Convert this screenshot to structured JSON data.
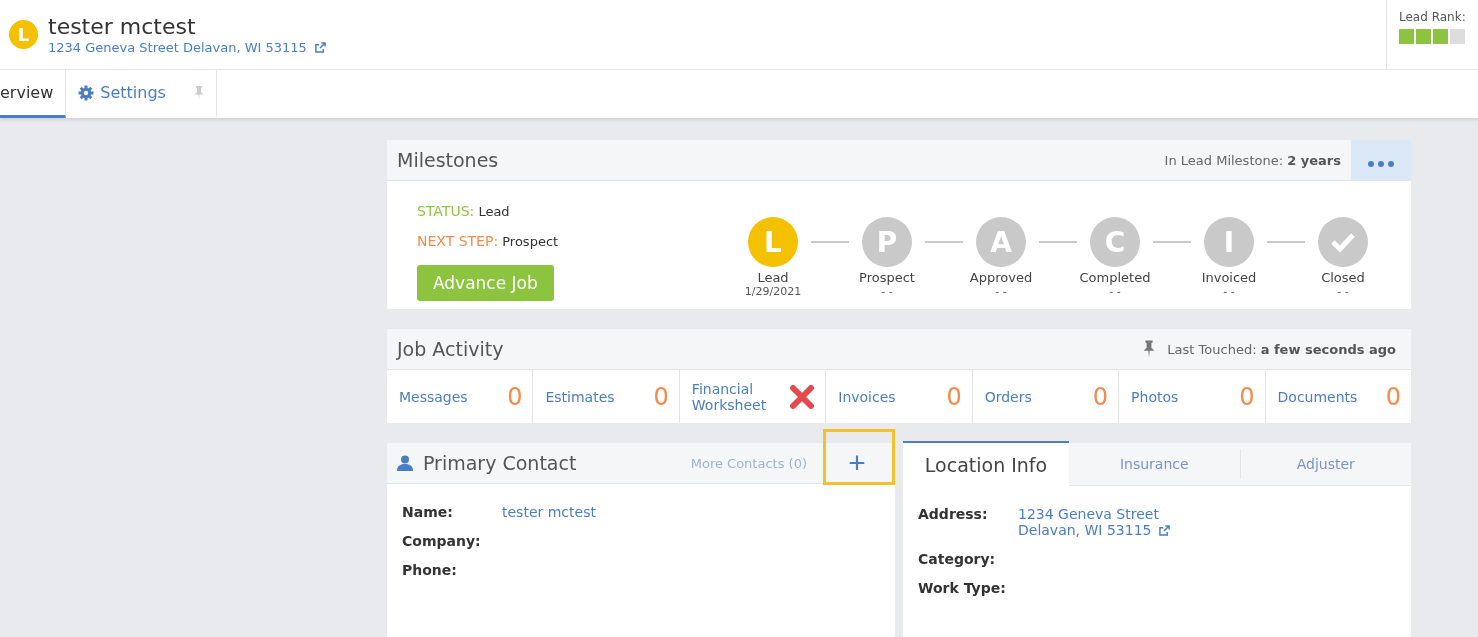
{
  "header": {
    "badge": "L",
    "name": "tester mctest",
    "address": "1234 Geneva Street Delavan, WI 53115",
    "lead_rank": {
      "label": "Lead Rank:",
      "stars": 3
    }
  },
  "tabs": [
    {
      "label": "erview",
      "selected": true
    },
    {
      "label": "Settings",
      "selected": false
    }
  ],
  "milestones": {
    "title": "Milestones",
    "duration_label": "In Lead Milestone:",
    "duration": "2 years",
    "status_label": "STATUS:",
    "status": "Lead",
    "next_label": "NEXT STEP:",
    "next": "Prospect",
    "button": "Advance Job",
    "steps": [
      {
        "kind": "letter",
        "glyph": "L",
        "name": "Lead",
        "date": "1/29/2021",
        "selected": true
      },
      {
        "kind": "letter",
        "glyph": "P",
        "name": "Prospect",
        "date": "- -",
        "selected": false
      },
      {
        "kind": "letter",
        "glyph": "A",
        "name": "Approved",
        "date": "- -",
        "selected": false
      },
      {
        "kind": "letter",
        "glyph": "C",
        "name": "Completed",
        "date": "- -",
        "selected": false
      },
      {
        "kind": "letter",
        "glyph": "I",
        "name": "Invoiced",
        "date": "- -",
        "selected": false
      },
      {
        "kind": "check",
        "name": "Closed",
        "date": "- -",
        "selected": false
      }
    ]
  },
  "job_activity": {
    "title": "Job Activity",
    "touched_label": "Last Touched:",
    "touched": "a few seconds ago",
    "items": [
      {
        "kind": "count",
        "label": "Messages",
        "count": "0"
      },
      {
        "kind": "count",
        "label": "Estimates",
        "count": "0"
      },
      {
        "kind": "missing",
        "label": "Financial Worksheet"
      },
      {
        "kind": "count",
        "label": "Invoices",
        "count": "0"
      },
      {
        "kind": "count",
        "label": "Orders",
        "count": "0"
      },
      {
        "kind": "count",
        "label": "Photos",
        "count": "0"
      },
      {
        "kind": "count",
        "label": "Documents",
        "count": "0"
      }
    ]
  },
  "primary_contact": {
    "title": "Primary Contact",
    "more": "More Contacts (0)",
    "add": "+",
    "fields": [
      {
        "label": "Name:",
        "value": "tester mctest"
      },
      {
        "label": "Company:"
      },
      {
        "label": "Phone:"
      }
    ]
  },
  "location": {
    "tabs": [
      {
        "label": "Location Info",
        "selected": true
      },
      {
        "label": "Insurance",
        "selected": false
      },
      {
        "label": "Adjuster",
        "selected": false
      }
    ],
    "fields": [
      {
        "label": "Address:",
        "lines": [
          "1234 Geneva Street",
          "Delavan, WI 53115"
        ]
      },
      {
        "label": "Category:"
      },
      {
        "label": "Work Type:"
      }
    ]
  }
}
